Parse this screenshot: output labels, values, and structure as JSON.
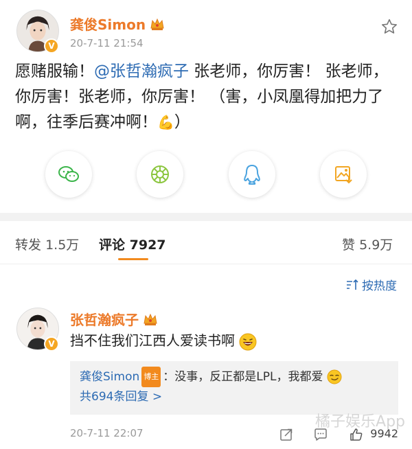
{
  "post": {
    "author_name": "龚俊Simon",
    "time": "20-7-11 21:54",
    "text_before": "愿赌服输！",
    "mention": "@张哲瀚疯子",
    "text_after": " 张老师，你厉害！ 张老师，你厉害！张老师，你厉害！ （害，小凤凰得加把力了啊，往季后赛冲啊！",
    "emoji": "💪",
    "text_end": "）"
  },
  "share": {
    "wechat": "wechat-icon",
    "moments": "moments-icon",
    "qq": "qq-icon",
    "save_image": "save-image-icon"
  },
  "tabs": {
    "repost_label": "转发",
    "repost_count": "1.5万",
    "comment_label": "评论",
    "comment_count": "7927",
    "like_label": "赞",
    "like_count": "5.9万"
  },
  "sort": {
    "label": "按热度"
  },
  "comment": {
    "author_name": "张哲瀚疯子",
    "text": "挡不住我们江西人爱读书啊",
    "reply_author": "龚俊Simon",
    "host_badge": "博主",
    "reply_text": "：没事，反正都是LPL，我都爱",
    "reply_more": "共694条回复 >",
    "time": "20-7-11 22:07",
    "likes": "9942"
  },
  "watermark": "橘子娱乐App",
  "colors": {
    "name_orange": "#ec7a2a",
    "link_blue": "#2d6bb3",
    "accent_orange": "#f28a1e"
  }
}
